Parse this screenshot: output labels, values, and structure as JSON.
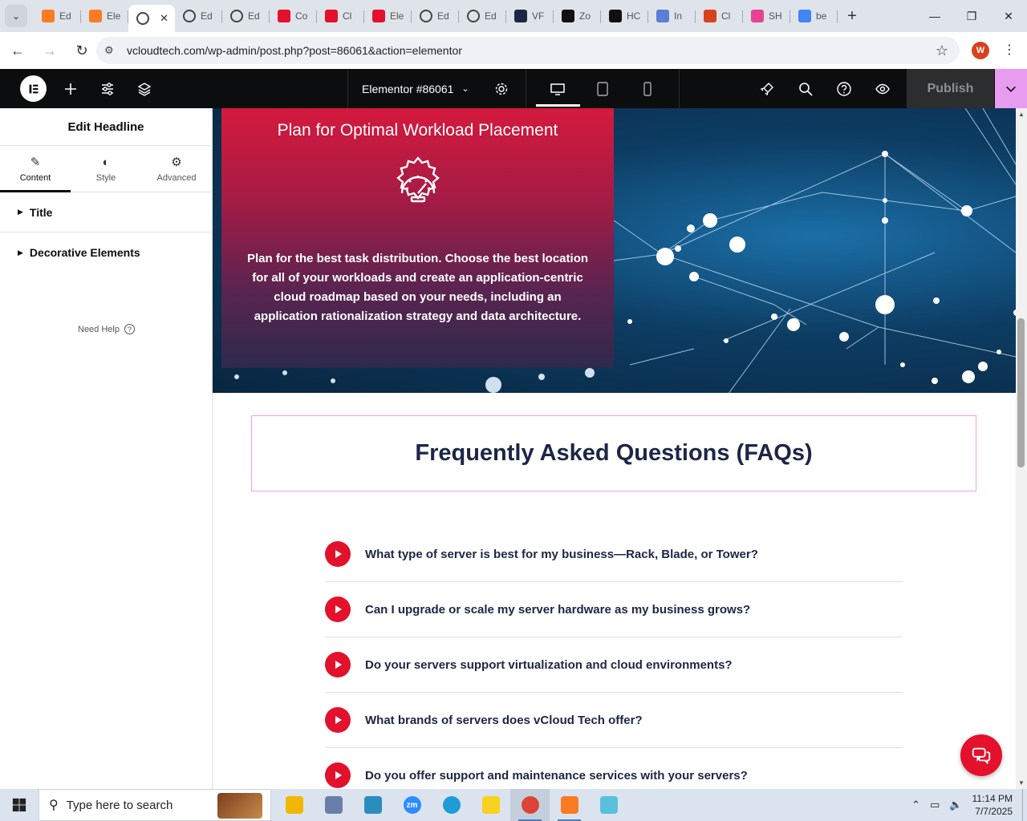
{
  "browser": {
    "tabs": [
      {
        "label": "Ed",
        "icon": "xampp-icon",
        "color": "#fb7a24"
      },
      {
        "label": "Ele",
        "icon": "xampp-icon",
        "color": "#fb7a24"
      },
      {
        "label": "",
        "icon": "globe-icon",
        "color": "#444444",
        "active": true
      },
      {
        "label": "Ed",
        "icon": "globe-icon",
        "color": "#444444"
      },
      {
        "label": "Ed",
        "icon": "globe-icon",
        "color": "#444444"
      },
      {
        "label": "Co",
        "icon": "diamond-icon",
        "color": "#e3112c"
      },
      {
        "label": "Cl",
        "icon": "diamond-icon",
        "color": "#e3112c"
      },
      {
        "label": "Ele",
        "icon": "diamond-icon",
        "color": "#e3112c"
      },
      {
        "label": "Ed",
        "icon": "globe-icon",
        "color": "#444444"
      },
      {
        "label": "Ed",
        "icon": "globe-icon",
        "color": "#444444"
      },
      {
        "label": "VF",
        "icon": "v-icon",
        "color": "#1c2645"
      },
      {
        "label": "Zo",
        "icon": "z-icon",
        "color": "#111111"
      },
      {
        "label": "HC",
        "icon": "openai-icon",
        "color": "#111111"
      },
      {
        "label": "In",
        "icon": "bird-icon",
        "color": "#5b7fd6"
      },
      {
        "label": "Cl",
        "icon": "claude-icon",
        "color": "#d9411e"
      },
      {
        "label": "SH",
        "icon": "circle-icon",
        "color": "#e84393"
      },
      {
        "label": "be",
        "icon": "google-icon",
        "color": "#4285f4"
      }
    ],
    "active_tab_close": "✕",
    "new_tab": "+",
    "url": "vcloudtech.com/wp-admin/post.php?post=86061&action=elementor",
    "profile_initial": "W",
    "window_controls": [
      "—",
      "❐",
      "✕"
    ]
  },
  "elementor": {
    "doc_title": "Elementor #86061",
    "publish_label": "Publish",
    "panel_title": "Edit Headline",
    "panel_tabs": [
      {
        "label": "Content",
        "icon": "pencil-icon",
        "glyph": "✎"
      },
      {
        "label": "Style",
        "icon": "half-circle-icon",
        "glyph": "◐"
      },
      {
        "label": "Advanced",
        "icon": "gear-icon",
        "glyph": "⚙"
      }
    ],
    "sections": [
      "Title",
      "Decorative Elements"
    ],
    "need_help": "Need Help",
    "need_help_glyph": "?"
  },
  "canvas": {
    "card_title": "Plan for Optimal Workload Placement",
    "card_body": "Plan for the best task distribution. Choose the best location for all of your workloads and create an application-centric cloud roadmap based on your needs, including an application rationalization strategy and data architecture.",
    "faq_title": "Frequently Asked Questions (FAQs)",
    "faqs": [
      "What type of server is best for my business—Rack, Blade, or Tower?",
      "Can I upgrade or scale my server hardware as my business grows?",
      "Do your servers support virtualization and cloud environments?",
      "What brands of servers does vCloud Tech offer?",
      "Do you offer support and maintenance services with your servers?"
    ],
    "accent": "#e3112c",
    "heading_color": "#1c2645"
  },
  "taskbar": {
    "search_placeholder": "Type here to search",
    "apps": [
      {
        "name": "file-explorer-icon",
        "color": "#f2b705",
        "label": ""
      },
      {
        "name": "paint-icon",
        "color": "#6a7fa8",
        "label": ""
      },
      {
        "name": "app-diamond-icon",
        "color": "#2b8cbe",
        "label": ""
      },
      {
        "name": "zoom-icon",
        "color": "#2d8cff",
        "label": "zm"
      },
      {
        "name": "edge-icon",
        "color": "#1f9bd6",
        "label": ""
      },
      {
        "name": "sticky-notes-icon",
        "color": "#f7d21f",
        "label": ""
      },
      {
        "name": "chrome-icon",
        "color": "#db4437",
        "label": "",
        "active": true
      },
      {
        "name": "xampp-icon",
        "color": "#fb7a24",
        "label": ""
      },
      {
        "name": "notepad-icon",
        "color": "#5bc0de",
        "label": ""
      }
    ],
    "time": "11:14 PM",
    "date": "7/7/2025"
  }
}
